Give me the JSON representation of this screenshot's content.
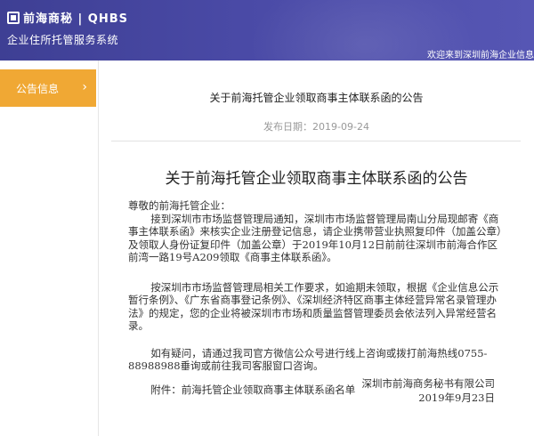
{
  "header": {
    "logo_line1": "前海商秘 | QHBS",
    "logo_line2": "企业住所托管服务系统",
    "welcome": "欢迎来到深圳前海企业信息"
  },
  "sidebar": {
    "items": [
      {
        "label": "公告信息",
        "active": true
      }
    ]
  },
  "notice": {
    "title": "关于前海托管企业领取商事主体联系函的公告",
    "publish_date": "发布日期：2019-09-24",
    "doc_title": "关于前海托管企业领取商事主体联系函的公告",
    "greeting": "尊敬的前海托管企业：",
    "paragraph1": "接到深圳市市场监督管理局通知，深圳市市场监督管理局南山分局现邮寄《商事主体联系函》来核实企业注册登记信息，请企业携带营业执照复印件（加盖公章）及领取人身份证复印件（加盖公章）于2019年10月12日前前往深圳市前海合作区前湾一路19号A209领取《商事主体联系函》。",
    "paragraph2": "按深圳市市场监督管理局相关工作要求，如逾期未领取，根据《企业信息公示暂行条例》、《广东省商事登记条例》、《深圳经济特区商事主体经营异常名录管理办法》的规定，您的企业将被深圳市市场和质量监督管理委员会依法列入异常经营名录。",
    "paragraph3": "如有疑问，请通过我司官方微信公众号进行线上咨询或拨打前海热线0755-88988988垂询或前往我司客服窗口咨询。",
    "attachment": "附件：前海托管企业领取商事主体联系函名单",
    "signature_company": "深圳市前海商务秘书有限公司",
    "signature_date": "2019年9月23日"
  },
  "colors": {
    "header_bg": "#4a4aa6",
    "sidebar_active": "#f0a834"
  }
}
